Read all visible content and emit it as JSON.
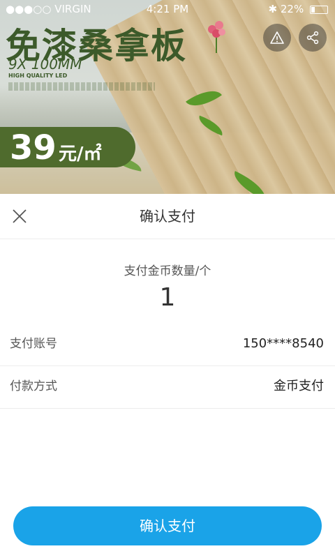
{
  "status_bar": {
    "carrier": "●●●○○ VIRGIN",
    "time": "4:21 PM",
    "battery": "22%"
  },
  "banner": {
    "title": "免漆桑拿板",
    "subtitle": "9X 100MM",
    "small_label": "HIGH QUALITY LED",
    "price_number": "39",
    "price_unit": "元/㎡"
  },
  "sheet": {
    "title": "确认支付",
    "amount_label": "支付金币数量/个",
    "amount_value": "1",
    "rows": [
      {
        "label": "支付账号",
        "value": "150****8540"
      },
      {
        "label": "付款方式",
        "value": "金币支付"
      }
    ],
    "confirm_label": "确认支付"
  },
  "colors": {
    "primary": "#1aa3e8",
    "price_tag": "#4f6b2d"
  }
}
